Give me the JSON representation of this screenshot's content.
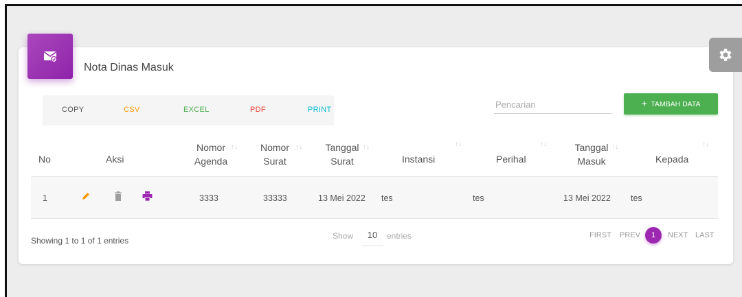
{
  "card": {
    "title": "Nota Dinas Masuk",
    "icon": "mail-check-icon",
    "accent": "#9c27b0"
  },
  "export": {
    "copy": "COPY",
    "csv": "CSV",
    "excel": "EXCEL",
    "pdf": "PDF",
    "print": "PRINT",
    "colors": {
      "copy": "#555555",
      "csv": "#ff9800",
      "excel": "#4caf50",
      "pdf": "#f44336",
      "print": "#00bcd4"
    }
  },
  "search": {
    "placeholder": "Pencarian"
  },
  "add_button": {
    "label": "TAMBAH DATA",
    "color": "#4caf50"
  },
  "table": {
    "headers": {
      "no": "No",
      "aksi": "Aksi",
      "nomor_agenda_1": "Nomor",
      "nomor_agenda_2": "Agenda",
      "nomor_surat_1": "Nomor",
      "nomor_surat_2": "Surat",
      "tanggal_surat_1": "Tanggal",
      "tanggal_surat_2": "Surat",
      "instansi": "Instansi",
      "perihal": "Perihal",
      "tanggal_masuk_1": "Tanggal",
      "tanggal_masuk_2": "Masuk",
      "kepada": "Kepada"
    },
    "rows": [
      {
        "no": "1",
        "nomor_agenda": "3333",
        "nomor_surat": "33333",
        "tanggal_surat": "13 Mei 2022",
        "instansi": "tes",
        "perihal": "tes",
        "tanggal_masuk": "13 Mei 2022",
        "kepada": "tes"
      }
    ]
  },
  "footer": {
    "info": "Showing 1 to 1 of 1 entries",
    "show": "Show",
    "page_size": "10",
    "entries": "entries"
  },
  "pagination": {
    "first": "FIRST",
    "prev": "PREV",
    "current": "1",
    "next": "NEXT",
    "last": "LAST"
  }
}
